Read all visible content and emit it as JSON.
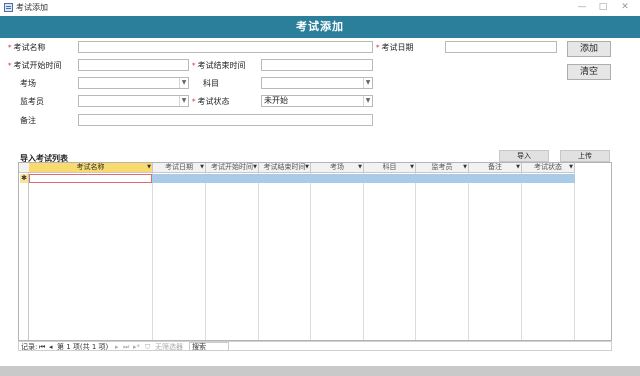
{
  "window": {
    "title": "考试添加",
    "minimize": "—",
    "maximize": "□",
    "close": "✕"
  },
  "header": {
    "title": "考试添加"
  },
  "form": {
    "exam_name": {
      "label": "考试名称",
      "value": ""
    },
    "exam_date": {
      "label": "考试日期",
      "value": ""
    },
    "start_time": {
      "label": "考试开始时间",
      "value": ""
    },
    "end_time": {
      "label": "考试结束时间",
      "value": ""
    },
    "room": {
      "label": "考场",
      "value": ""
    },
    "subject": {
      "label": "科目",
      "value": ""
    },
    "proctor": {
      "label": "监考员",
      "value": ""
    },
    "status": {
      "label": "考试状态",
      "value": "未开始"
    },
    "remark": {
      "label": "备注",
      "value": ""
    },
    "required_mark": "*"
  },
  "buttons": {
    "add": "添加",
    "clear": "清空",
    "import": "导入",
    "upload": "上传"
  },
  "import_list": {
    "title": "导入考试列表",
    "columns": [
      "考试名称",
      "考试日期",
      "考试开始时间",
      "考试结束时间",
      "考场",
      "科目",
      "监考员",
      "备注",
      "考试状态"
    ],
    "new_row_marker": "✱"
  },
  "record_nav": {
    "label": "记录:",
    "first": "⏮",
    "prev": "◂",
    "position": "第 1 项(共 1 项)",
    "next": "▸",
    "last": "⏭",
    "new": "▸*",
    "filter": "无筛选器",
    "search": "搜索"
  }
}
